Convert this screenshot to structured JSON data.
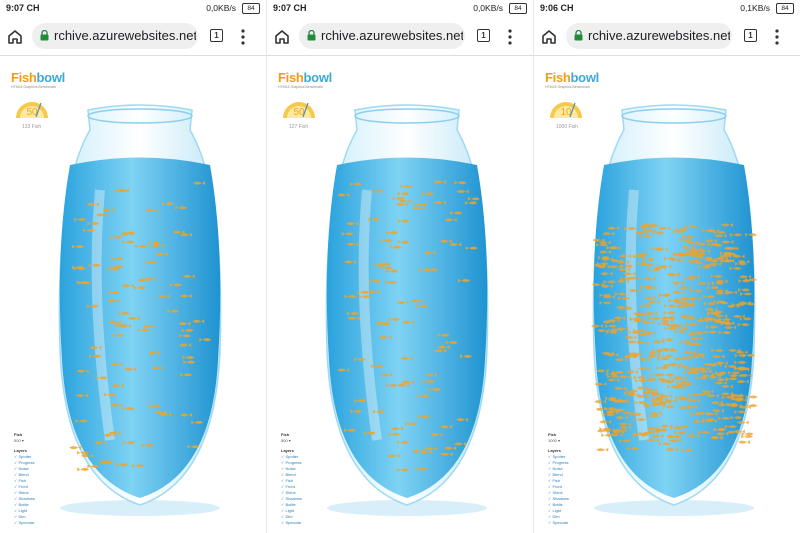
{
  "screens": [
    {
      "status": {
        "time": "9:07 CH",
        "net": "0,0KB/s",
        "battery": "84"
      },
      "url": "rchive.azurewebsites.net",
      "tabs_count": "1",
      "gauge_value": "50",
      "fish_count": "133 Fish",
      "fish_value": "500",
      "swarm": false
    },
    {
      "status": {
        "time": "9:07 CH",
        "net": "0,0KB/s",
        "battery": "84"
      },
      "url": "rchive.azurewebsites.net",
      "tabs_count": "1",
      "gauge_value": "50",
      "fish_count": "127 Fish",
      "fish_value": "500",
      "swarm": false
    },
    {
      "status": {
        "time": "9:06 CH",
        "net": "0,1KB/s",
        "battery": "84"
      },
      "url": "rchive.azurewebsites.net",
      "tabs_count": "1",
      "gauge_value": "10",
      "fish_count": "1000 Fish",
      "fish_value": "1000",
      "swarm": true
    }
  ],
  "app": {
    "logo_fish": "Fish",
    "logo_bowl": "bowl",
    "logo_subtitle": "HTML5 Graphics Benchmark",
    "fish_label": "Fish",
    "layers_label": "Layers",
    "layers": [
      "Spotter",
      "Progress",
      "Noise",
      "Blend",
      "Fish",
      "Front",
      "Shine",
      "Shadows",
      "Bottle",
      "Light",
      "Dim",
      "Specular"
    ]
  },
  "colors": {
    "accent": "#3fa9d6",
    "fish": "#f0a32a",
    "water": "#3fb4e6"
  }
}
